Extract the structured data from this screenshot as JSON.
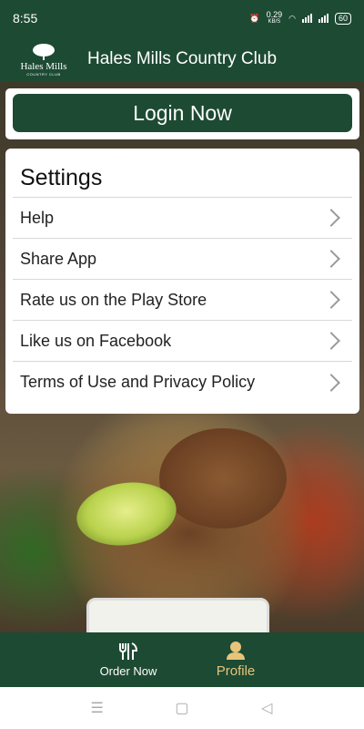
{
  "status_bar": {
    "time": "8:55",
    "speed": "0.29",
    "speed_unit": "KB/S",
    "battery": "60"
  },
  "header": {
    "logo_text": "Hales Mills",
    "logo_subtext": "COUNTRY CLUB",
    "title": "Hales Mills Country Club"
  },
  "login": {
    "button_label": "Login Now"
  },
  "settings": {
    "title": "Settings",
    "items": [
      {
        "label": "Help"
      },
      {
        "label": "Share App"
      },
      {
        "label": "Rate us on the Play Store"
      },
      {
        "label": "Like us on Facebook"
      },
      {
        "label": "Terms of Use and Privacy Policy"
      }
    ]
  },
  "tabs": [
    {
      "label": "Order Now",
      "icon": "dining-icon",
      "active": false
    },
    {
      "label": "Profile",
      "icon": "person-icon",
      "active": true
    }
  ],
  "colors": {
    "brand": "#1d4a33",
    "accent": "#e6c57a"
  }
}
